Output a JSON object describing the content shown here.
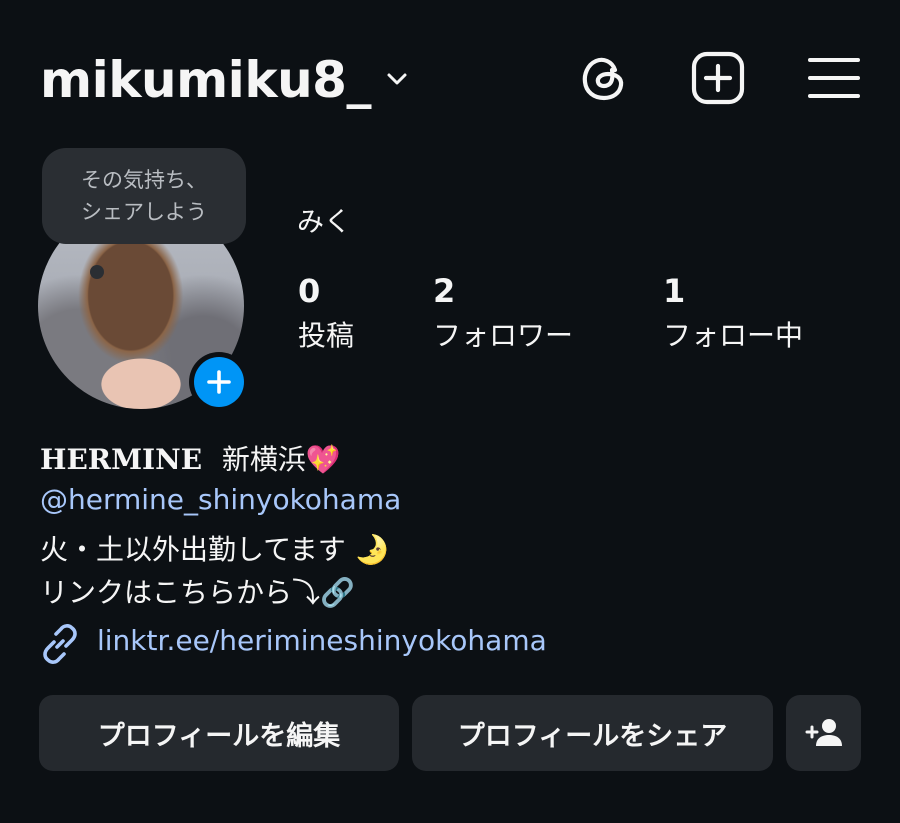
{
  "header": {
    "username": "mikumiku8_",
    "icons": [
      "chevron-down-icon",
      "threads-icon",
      "new-post-icon",
      "menu-icon"
    ]
  },
  "profile": {
    "note_bubble": [
      "その気持ち、",
      "シェアしよう"
    ],
    "display_name": "みく",
    "stats": [
      {
        "value": "0",
        "label": "投稿"
      },
      {
        "value": "2",
        "label": "フォロワー"
      },
      {
        "value": "1",
        "label": "フォロー中"
      }
    ]
  },
  "bio": {
    "line1_name": "HERMINE",
    "line1_place": "新横浜",
    "line1_emoji": "💖",
    "mention": "@hermine_shinyokohama",
    "line3": "火・土以外出勤してます",
    "line3_emoji": "🌛",
    "line4": "リンクはこちらから⤵︎",
    "line4_emoji": "🔗",
    "link": "linktr.ee/herimineshinyokohama"
  },
  "buttons": {
    "edit_profile": "プロフィールを編集",
    "share_profile": "プロフィールをシェア"
  },
  "colors": {
    "background": "#0c1014",
    "button": "#25292e",
    "link": "#a8c7fa",
    "accent": "#0095f6"
  }
}
